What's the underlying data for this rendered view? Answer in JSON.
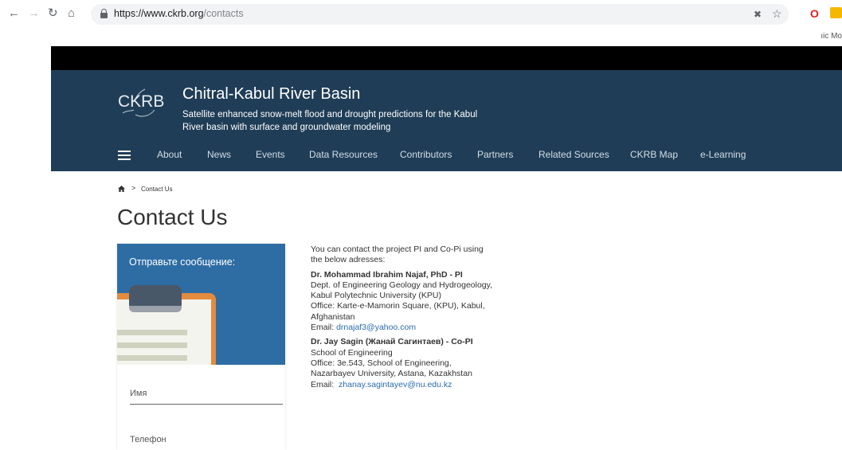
{
  "browser": {
    "url_host": "https://www.ckrb.org",
    "url_path": "/contacts",
    "tooltip_fragment": "ıic Mo"
  },
  "site": {
    "logo_text": "CKRB",
    "title": "Chitral-Kabul River Basin",
    "subtitle": "Satellite enhanced snow-melt flood and drought predictions for the Kabul River basin with surface and groundwater modeling",
    "nav": [
      "About",
      "News",
      "Events",
      "Data Resources",
      "Contributors",
      "Partners",
      "Related Sources",
      "CKRB Map",
      "e-Learning"
    ]
  },
  "breadcrumb": {
    "current": "Contact Us",
    "separator": ">"
  },
  "page_title": "Contact Us",
  "form": {
    "heading": "Отправьте сообщение:",
    "fields": [
      "Имя",
      "Телефон"
    ]
  },
  "contact": {
    "intro": "You can contact the project PI and Co-Pi using the below adresses:",
    "pi": {
      "name": "Dr. Mohammad Ibrahim Najaf, PhD - PI",
      "dept": "Dept. of Engineering Geology and Hydrogeology, Kabul Polytechnic University (KPU)",
      "office": "Office: Karte-e-Mamorin Square, (KPU), Kabul, Afghanistan",
      "email_label": "Email: ",
      "email": "drnajaf3@yahoo.com"
    },
    "copi": {
      "name": "Dr. Jay Sagin (Жанай Сагинтаев) - Co-PI",
      "school": "School of Engineering",
      "office": "Office: 3e.543, School of Engineering, Nazarbayev University, Astana, Kazakhstan",
      "email_label": "Email:  ",
      "email": "zhanay.sagintayev@nu.edu.kz"
    }
  },
  "colors": {
    "header_bg": "#1f3d57",
    "form_head": "#2e6da4",
    "link": "#2a6cb0"
  }
}
